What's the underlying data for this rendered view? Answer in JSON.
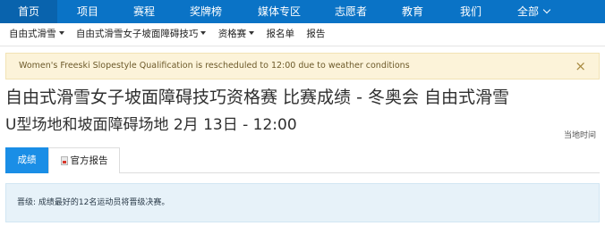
{
  "nav": {
    "items": [
      {
        "label": "首页"
      },
      {
        "label": "项目"
      },
      {
        "label": "赛程"
      },
      {
        "label": "奖牌榜"
      },
      {
        "label": "媒体专区"
      },
      {
        "label": "志愿者"
      },
      {
        "label": "教育"
      },
      {
        "label": "我们"
      },
      {
        "label": "全部"
      }
    ],
    "active_index": 0,
    "color": "#0a73c6"
  },
  "breadcrumb": {
    "items": [
      {
        "label": "自由式滑雪",
        "dropdown": true
      },
      {
        "label": "自由式滑雪女子坡面障碍技巧",
        "dropdown": true
      },
      {
        "label": "资格赛",
        "dropdown": true
      },
      {
        "label": "报名单",
        "dropdown": false
      },
      {
        "label": "报告",
        "dropdown": false
      }
    ]
  },
  "alert": {
    "text": "Women's Freeski Slopestyle Qualification is rescheduled to 12:00 due to weather conditions",
    "close_symbol": "×"
  },
  "header": {
    "title": "自由式滑雪女子坡面障碍技巧资格赛 比赛成绩 - 冬奥会 自由式滑雪",
    "subtitle": "U型场地和坡面障碍场地 2月 13日 - 12:00",
    "local_time_label": "当地时间"
  },
  "tabs": [
    {
      "label": "成绩",
      "active": true
    },
    {
      "label": "官方报告",
      "active": false,
      "icon": "pdf-icon"
    }
  ],
  "info": {
    "text": "晋级: 成绩最好的12名运动员将晋级决赛。"
  },
  "colors": {
    "accent": "#1a8ee6",
    "alert_bg": "#fcf3d9",
    "info_bg": "#e7f2f9"
  }
}
